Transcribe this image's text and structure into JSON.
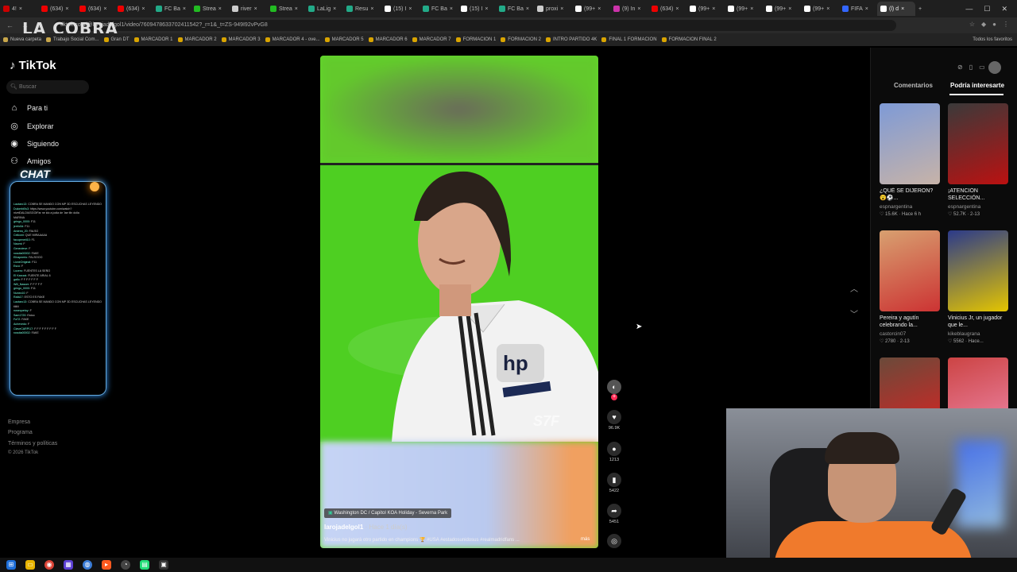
{
  "browser": {
    "stream_overlay": "LA COBRA",
    "tabs": [
      {
        "label": "4!",
        "color": "#c00"
      },
      {
        "label": "(634)",
        "color": "#e00"
      },
      {
        "label": "(634)",
        "color": "#e00"
      },
      {
        "label": "(634)",
        "color": "#e00"
      },
      {
        "label": "FC Ba",
        "color": "#2a8"
      },
      {
        "label": "Strea",
        "color": "#2b2"
      },
      {
        "label": "river",
        "color": "#ccc"
      },
      {
        "label": "Strea",
        "color": "#2b2"
      },
      {
        "label": "LaLig",
        "color": "#2a8"
      },
      {
        "label": "Resu",
        "color": "#2a8"
      },
      {
        "label": "(15) I",
        "color": "#fff"
      },
      {
        "label": "FC Ba",
        "color": "#2a8"
      },
      {
        "label": "(15) I",
        "color": "#fff"
      },
      {
        "label": "FC Ba",
        "color": "#2a8"
      },
      {
        "label": "proxi",
        "color": "#ccc"
      },
      {
        "label": "(99+",
        "color": "#fff"
      },
      {
        "label": "(9) In",
        "color": "#c3a"
      },
      {
        "label": "(634)",
        "color": "#e00"
      },
      {
        "label": "(99+",
        "color": "#fff"
      },
      {
        "label": "(99+",
        "color": "#fff"
      },
      {
        "label": "(99+",
        "color": "#fff"
      },
      {
        "label": "(99+",
        "color": "#fff"
      },
      {
        "label": "FIFA",
        "color": "#36f"
      },
      {
        "label": "(l) d",
        "color": "#fff"
      }
    ],
    "url": "tiktok.com/@larojadelgol1/video/7609478633702411542?_r=1&_t=ZS-949I92vPvG8",
    "bookmarks": [
      "Nueva carpeta",
      "Trabajo Social Com...",
      "Gran DT",
      "MARCADOR 1",
      "MARCADOR 2",
      "MARCADOR 3",
      "MARCADOR 4 - ove...",
      "MARCADOR 5",
      "MARCADOR 6",
      "MARCADOR 7",
      "FORMACION 1",
      "FORMACION 2",
      "INTRO PARTIDO 4K",
      "FINAL 1 FORMACION",
      "FORMACION FINAL 2"
    ],
    "all_bookmarks": "Todos los favoritos"
  },
  "sidebar": {
    "logo": "TikTok",
    "search_placeholder": "Buscar",
    "nav": [
      {
        "label": "Para ti",
        "icon": "home-icon"
      },
      {
        "label": "Explorar",
        "icon": "compass-icon"
      },
      {
        "label": "Siguiendo",
        "icon": "following-icon"
      },
      {
        "label": "Amigos",
        "icon": "friends-icon"
      }
    ],
    "chat_title": "CHAT",
    "chat_messages": [
      {
        "user": "Lautaro13:",
        "text": "COBRA SE MANDO CON MP 3D ESCUCHAS LEYENDO"
      },
      {
        "user": "Dulombi0s3:",
        "text": "https://www.youtube.com/watch?"
      },
      {
        "user": "",
        "text": "nivelDALDIASGOIFar ne ido a jodia de 'lae tiln dolla"
      },
      {
        "user": "",
        "text": "MARINA"
      },
      {
        "user": "gringo_0000:",
        "text": "F11"
      },
      {
        "user": "jerrfo0d:",
        "text": "F11"
      },
      {
        "user": "Andrea_20:",
        "text": "FALSO"
      },
      {
        "user": "Celiconi:",
        "text": "QUE MIRAAAAA"
      },
      {
        "user": "facupeneti10:",
        "text": "F1"
      },
      {
        "user": "Naomi:",
        "text": "F"
      },
      {
        "user": "Genevieve:",
        "text": "F"
      },
      {
        "user": "rossita00002:",
        "text": "FAKE"
      },
      {
        "user": "Elirapnerlo:",
        "text": "FALSOOO"
      },
      {
        "user": "LioneOriginal:",
        "text": "F11"
      },
      {
        "user": "Esco:",
        "text": "F"
      },
      {
        "user": "Lucero:",
        "text": "FUENTES LA SEÑO"
      },
      {
        "user": "El Karzzai:",
        "text": "FUENTE ARIAL 6"
      },
      {
        "user": "gallo:",
        "text": "F F F F F F F"
      },
      {
        "user": "Will_Nasser:",
        "text": "F F F F F"
      },
      {
        "user": "gringo_0000:",
        "text": "F11"
      },
      {
        "user": "Nunez10:",
        "text": "F"
      },
      {
        "user": "Rafa17:",
        "text": "ESTO ES FAKE"
      },
      {
        "user": "Lautaro13:",
        "text": "COBRA SE MANDO CON MP 3D ESCUCHAS LEYENDO"
      },
      {
        "user": "",
        "text": "tiiiiiii"
      },
      {
        "user": "nosequetoy:",
        "text": "F"
      },
      {
        "user": "Sam1720:",
        "text": "Estoo"
      },
      {
        "user": "Fa72:",
        "text": "FAKE"
      },
      {
        "user": "Achevedo:",
        "text": "F"
      },
      {
        "user": "ClaveCARPI17:",
        "text": "F F F F F F F F F"
      },
      {
        "user": "rossita00002:",
        "text": "FAKE"
      }
    ],
    "footer": [
      "Empresa",
      "Programa",
      "Términos y políticas",
      "© 2026 TikTok"
    ]
  },
  "video": {
    "watermark": "S7F",
    "location": "Washington DC / Capitol KOA Holiday - Severna Park",
    "author": "larojadelgol1",
    "time": "· Hace 1 día(s)",
    "caption": "Vinicius no jugará otro partido en champions 🏆 #USA #estadosunidosus #realmadridfans ...",
    "more": "más"
  },
  "actions": {
    "likes": "96.9K",
    "comments": "1213",
    "saves": "5422",
    "shares": "5451"
  },
  "right_panel": {
    "tabs": [
      "Comentarios",
      "Podría interesarte"
    ],
    "cards": [
      {
        "title": "¿QUÉ SE DIJERON? 😮⚽...",
        "author": "espnargentina",
        "meta": "♡ 15.6K · Hace 6 h",
        "colors": [
          "#7e9ad6",
          "#c7b3a8"
        ]
      },
      {
        "title": "¡ATENCIÓN SELECCIÓN...",
        "author": "espnargentina",
        "meta": "♡ 52.7K · 2-13",
        "colors": [
          "#3a3a3a",
          "#b11"
        ]
      },
      {
        "title": "Pereira y agutín celebrando la...",
        "author": "castorcin07",
        "meta": "♡ 2780 · 2-13",
        "colors": [
          "#d8a070",
          "#c33"
        ]
      },
      {
        "title": "Vinicius Jr, un jugador que le...",
        "author": "kikeblaugrana",
        "meta": "♡ 5562 · Hace...",
        "colors": [
          "#2b3a8a",
          "#e4c500"
        ]
      },
      {
        "title": "",
        "author": "",
        "meta": "",
        "colors": [
          "#6a4a3a",
          "#d22"
        ]
      },
      {
        "title": "",
        "author": "",
        "meta": "",
        "colors": [
          "#c44",
          "#e8a"
        ]
      }
    ]
  }
}
